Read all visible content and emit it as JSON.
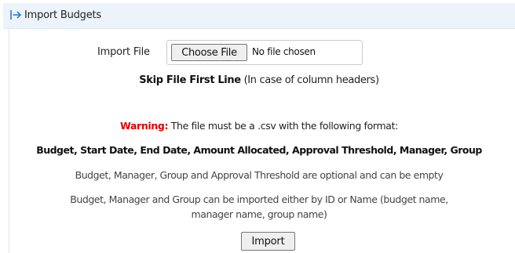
{
  "panel": {
    "title": "Import Budgets",
    "icon": "sign-in-icon"
  },
  "file_input": {
    "label": "Import File",
    "button_label": "Choose File",
    "status": "No file chosen"
  },
  "skip_option": {
    "label": "Skip File First Line",
    "note": "(In case of column headers)"
  },
  "instructions": {
    "warning_label": "Warning:",
    "warning_text": "The file must be a .csv with the following format:",
    "format": "Budget, Start Date, End Date, Amount Allocated, Approval Threshold, Manager, Group",
    "optional_note": "Budget, Manager, Group and Approval Threshold are optional and can be empty",
    "id_note_line1": "Budget, Manager and Group can be imported either by ID or Name (budget name,",
    "id_note_line2": "manager name, group name)"
  },
  "actions": {
    "import_label": "Import"
  },
  "colors": {
    "header_bg": "#edf3fb",
    "icon": "#2a7fd4",
    "warning": "#e00000"
  }
}
